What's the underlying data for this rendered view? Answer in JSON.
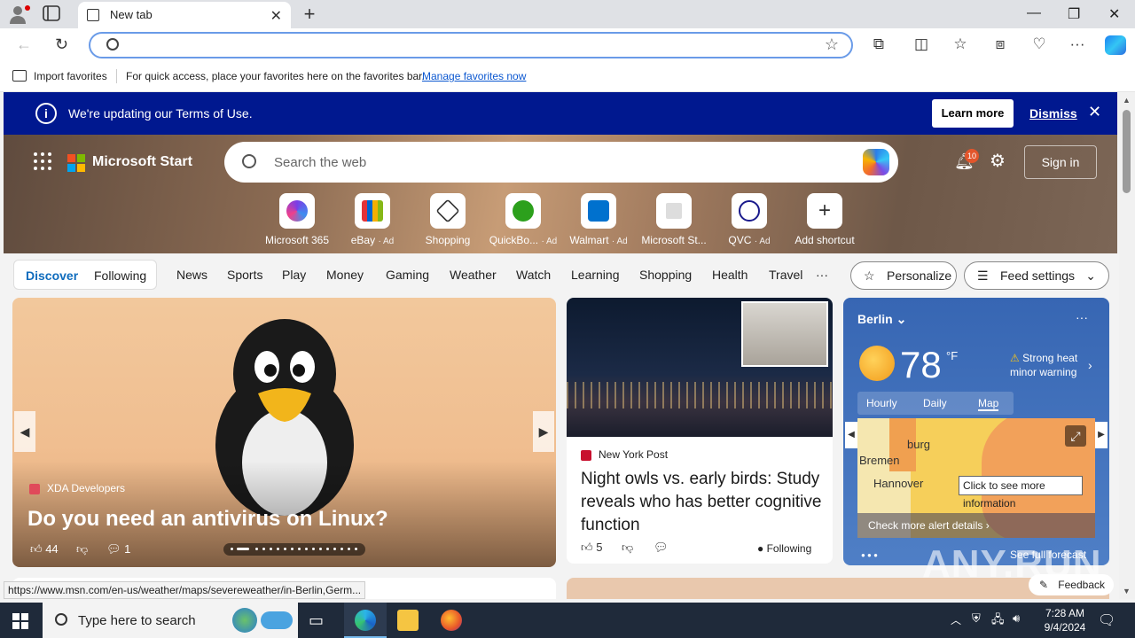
{
  "browser": {
    "tab_title": "New tab",
    "favorites": {
      "import_label": "Import favorites",
      "message": "For quick access, place your favorites here on the favorites bar.",
      "manage_link": "Manage favorites now"
    }
  },
  "banner": {
    "text": "We're updating our Terms of Use.",
    "learn_more": "Learn more",
    "dismiss": "Dismiss"
  },
  "header": {
    "brand": "Microsoft Start",
    "search_placeholder": "Search the web",
    "notification_count": "10",
    "sign_in": "Sign in"
  },
  "shortcuts": [
    {
      "label": "Microsoft 365",
      "ad": ""
    },
    {
      "label": "eBay",
      "ad": "· Ad"
    },
    {
      "label": "Shopping",
      "ad": ""
    },
    {
      "label": "QuickBo...",
      "ad": "· Ad"
    },
    {
      "label": "Walmart",
      "ad": "· Ad"
    },
    {
      "label": "Microsoft St...",
      "ad": ""
    },
    {
      "label": "QVC",
      "ad": "· Ad"
    },
    {
      "label": "Add shortcut",
      "ad": ""
    }
  ],
  "nav": {
    "discover": "Discover",
    "following": "Following",
    "links": [
      "News",
      "Sports",
      "Play",
      "Money",
      "Gaming",
      "Weather",
      "Watch",
      "Learning",
      "Shopping",
      "Health",
      "Travel"
    ],
    "more": "···",
    "personalize": "Personalize",
    "feed_settings": "Feed settings"
  },
  "feature_card": {
    "source": "XDA Developers",
    "title": "Do you need an antivirus on Linux?",
    "likes": "44",
    "comments": "1"
  },
  "news_card": {
    "source": "New York Post",
    "title": "Night owls vs. early birds: Study reveals who has better cognitive function",
    "likes": "5",
    "following": "Following"
  },
  "weather": {
    "city": "Berlin",
    "temp": "78",
    "unit": "°F",
    "alert": "Strong heat minor warning",
    "tabs": [
      "Hourly",
      "Daily",
      "Map"
    ],
    "map_labels": [
      "burg",
      "Bremen",
      "Hannover"
    ],
    "tooltip": "Click to see more information",
    "check_alerts": "Check more alert details",
    "forecast": "See full forecast"
  },
  "status_url": "https://www.msn.com/en-us/weather/maps/severeweather/in-Berlin,Germ...",
  "feedback": "Feedback",
  "watermark": "ANY.RUN",
  "taskbar": {
    "search_placeholder": "Type here to search",
    "time": "7:28 AM",
    "date": "9/4/2024"
  },
  "colors": {
    "banner_bg": "#00188f",
    "accent": "#0f6cbd",
    "taskbar_bg": "#1f2a3a"
  }
}
